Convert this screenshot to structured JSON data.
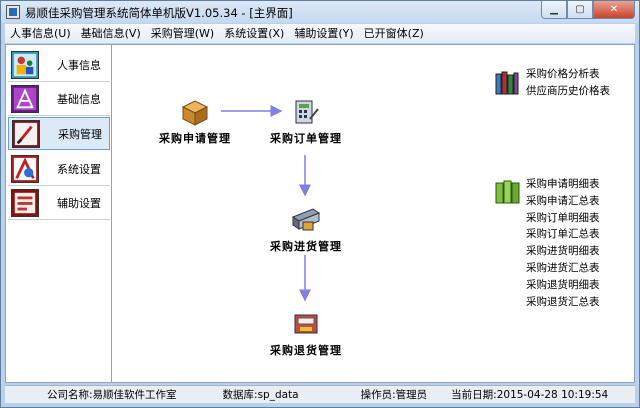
{
  "window": {
    "title": "易顺佳采购管理系统简体单机版V1.05.34 - [主界面]",
    "controls": {
      "minimize": "▁",
      "maximize": "▢",
      "close": "✕"
    }
  },
  "menu": [
    {
      "label": "人事信息(U)"
    },
    {
      "label": "基础信息(V)"
    },
    {
      "label": "采购管理(W)"
    },
    {
      "label": "系统设置(X)"
    },
    {
      "label": "辅助设置(Y)"
    },
    {
      "label": "已开窗体(Z)"
    }
  ],
  "sidebar": {
    "items": [
      {
        "label": "人事信息",
        "icon": "personnel-icon"
      },
      {
        "label": "基础信息",
        "icon": "basic-info-icon"
      },
      {
        "label": "采购管理",
        "icon": "procurement-icon",
        "active": true
      },
      {
        "label": "系统设置",
        "icon": "settings-icon"
      },
      {
        "label": "辅助设置",
        "icon": "auxiliary-icon"
      }
    ]
  },
  "flow": {
    "request": "采购申请管理",
    "order": "采购订单管理",
    "receipt": "采购进货管理",
    "return": "采购退货管理"
  },
  "reports": {
    "price": [
      "采购价格分析表",
      "供应商历史价格表"
    ],
    "details": [
      "采购申请明细表",
      "采购申请汇总表",
      "采购订单明细表",
      "采购订单汇总表",
      "采购进货明细表",
      "采购进货汇总表",
      "采购退货明细表",
      "采购退货汇总表"
    ]
  },
  "status": {
    "company": "公司名称:易顺佳软件工作室",
    "database": "数据库:sp_data",
    "operator": "操作员:管理员",
    "date": "当前日期:2015-04-28 10:19:54"
  },
  "colors": {
    "arrow": "#8080e0",
    "active_bg": "#dce9f7",
    "frame": "#b9d1ea"
  }
}
